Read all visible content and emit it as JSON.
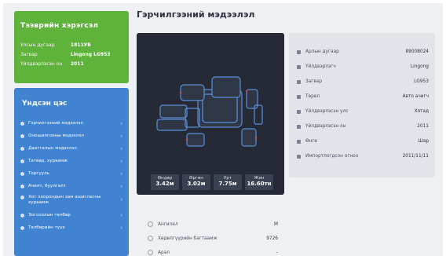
{
  "vehicle_card": {
    "title": "Тээврийн хэрэгсэл",
    "rows": [
      {
        "label": "Улсын дугаар",
        "value": "1811УБ"
      },
      {
        "label": "Загвар",
        "value": "Lingong LG953"
      },
      {
        "label": "Үйлдвэрлэсэн он",
        "value": "2011"
      }
    ]
  },
  "menu": {
    "title": "Үндсэн цэс",
    "items": [
      {
        "label": "Гэрчилгээний мэдээлэл"
      },
      {
        "label": "Оношилгооны мэдээлэл"
      },
      {
        "label": "Даатгалын мэдээлэл"
      },
      {
        "label": "Татвар, хураамж"
      },
      {
        "label": "Торгууль"
      },
      {
        "label": "Ачилт, буулгалт"
      },
      {
        "label": "Хот хоорондын зам ашигласны хураамж"
      },
      {
        "label": "Зогсоолын төлбөр"
      },
      {
        "label": "Төлбөрийн түүх"
      }
    ]
  },
  "page": {
    "title": "Гэрчилгээний мэдээлэл"
  },
  "dimensions": [
    {
      "label": "Өндөр",
      "value": "3.42м"
    },
    {
      "label": "Өргөн",
      "value": "3.02м"
    },
    {
      "label": "Урт",
      "value": "7.75м"
    },
    {
      "label": "Жин",
      "value": "16.60тн"
    }
  ],
  "specs": [
    {
      "icon": "id-card-icon",
      "label": "Арлын дугаар",
      "value": "89008024"
    },
    {
      "icon": "factory-icon",
      "label": "Үйлдвэрлэгч",
      "value": "Lingong"
    },
    {
      "icon": "model-icon",
      "label": "Загвар",
      "value": "LG953"
    },
    {
      "icon": "vehicle-type-icon",
      "label": "Төрөл",
      "value": "Авто ачигч"
    },
    {
      "icon": "flag-icon",
      "label": "Үйлдвэрлэсэн улс",
      "value": "Хятад"
    },
    {
      "icon": "calendar-icon",
      "label": "Үйлдвэрлэсэн он",
      "value": "2011"
    },
    {
      "icon": "color-icon",
      "label": "Өнгө",
      "value": "Шар"
    },
    {
      "icon": "import-date-icon",
      "label": "Импортлогдсон огноо",
      "value": "2011/11/11"
    }
  ],
  "extra": [
    {
      "icon": "circle-icon",
      "label": "Ангилал",
      "value": "M"
    },
    {
      "icon": "circle-icon",
      "label": "Хөдөлгүүрийн багтаамж",
      "value": "9726"
    },
    {
      "icon": "circle-icon",
      "label": "Арал",
      "value": "-"
    }
  ],
  "colors": {
    "vehicle_card_bg": "#5fb23a",
    "menu_bg": "#3f83d1",
    "car_panel_bg": "#252a36",
    "specs_panel_bg": "#e2e4e9"
  }
}
